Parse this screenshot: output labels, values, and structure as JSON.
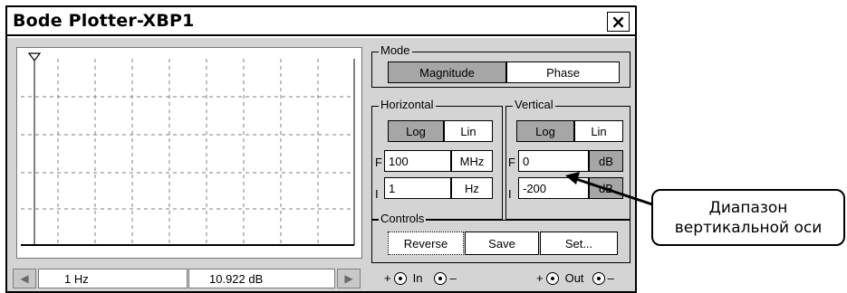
{
  "window": {
    "title": "Bode Plotter-XBP1",
    "close_label": "×"
  },
  "status": {
    "freq": "1  Hz",
    "value": "10.922 dB"
  },
  "mode": {
    "label": "Mode",
    "magnitude": "Magnitude",
    "phase": "Phase",
    "selected": "Magnitude"
  },
  "horizontal": {
    "label": "Horizontal",
    "log": "Log",
    "lin": "Lin",
    "selected": "Log",
    "f_label": "F",
    "i_label": "I",
    "f_value": "100",
    "f_unit": "MHz",
    "i_value": "1",
    "i_unit": "Hz"
  },
  "vertical": {
    "label": "Vertical",
    "log": "Log",
    "lin": "Lin",
    "selected": "Log",
    "f_label": "F",
    "i_label": "I",
    "f_value": "0",
    "f_unit": "dB",
    "i_value": "-200",
    "i_unit": "dB"
  },
  "controls": {
    "label": "Controls",
    "reverse": "Reverse",
    "save": "Save",
    "set": "Set..."
  },
  "terminals": {
    "in_plus": "+",
    "in_label": "In",
    "in_minus": "–",
    "out_plus": "+",
    "out_label": "Out",
    "out_minus": "–"
  },
  "callout": {
    "line1": "Диапазон",
    "line2": "вертикальной оси"
  }
}
